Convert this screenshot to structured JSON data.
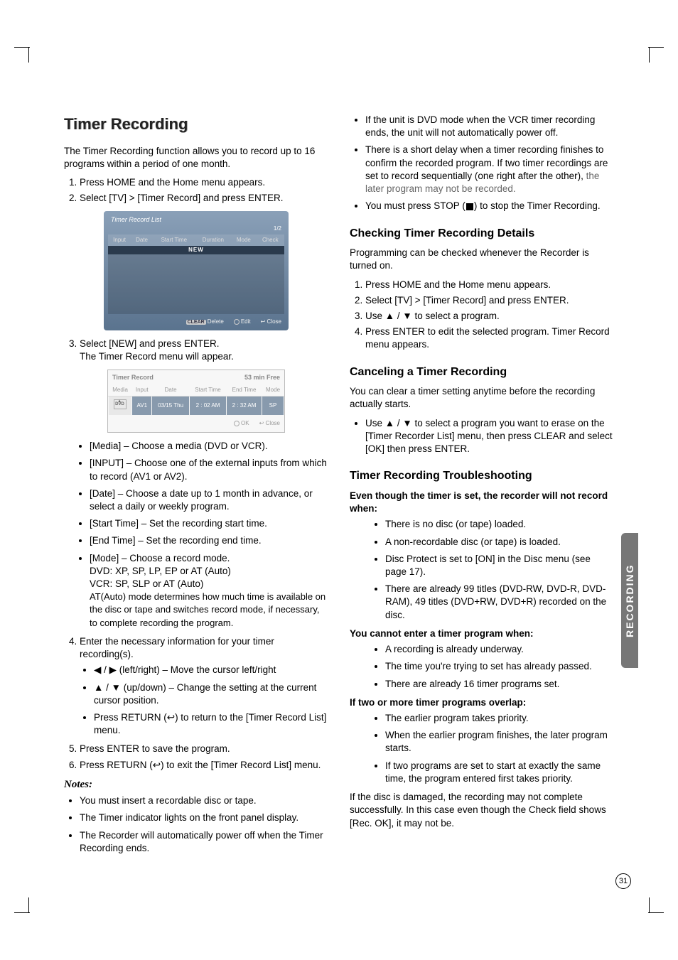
{
  "sideTab": "RECORDING",
  "pageNumber": "31",
  "left": {
    "title": "Timer Recording",
    "intro": "The Timer Recording function allows you to record up to 16 programs within a period of one month.",
    "steps1": [
      "Press HOME and the Home menu appears.",
      "Select [TV] > [Timer Record] and press ENTER."
    ],
    "shot1": {
      "title": "Timer Record List",
      "page": "1/2",
      "cols": [
        "Input",
        "Date",
        "Start Time",
        "Duration",
        "Mode",
        "Check"
      ],
      "new": "NEW",
      "foot_delete": "Delete",
      "foot_delete_key": "CLEAR",
      "foot_edit": "Edit",
      "foot_close": "Close"
    },
    "step3_a": "Select [NEW] and press ENTER.",
    "step3_b": "The Timer Record menu will appear.",
    "shot2": {
      "title": "Timer Record",
      "free": "53  min Free",
      "cols": [
        "Media",
        "Input",
        "Date",
        "Start Time",
        "End Time",
        "Mode"
      ],
      "row": [
        "",
        "AV1",
        "03/15 Thu",
        "2 : 02 AM",
        "2 : 32 AM",
        "SP"
      ],
      "foot_ok": "OK",
      "foot_close": "Close"
    },
    "defs": [
      "[Media] – Choose a media (DVD or VCR).",
      "[INPUT] – Choose one of the external inputs from which to record (AV1 or AV2).",
      "[Date] – Choose a date up to 1 month in advance, or select a daily or weekly program.",
      "[Start Time] – Set the recording start time.",
      "[End Time] – Set the recording end time."
    ],
    "mode_a": "[Mode] – Choose a record mode.",
    "mode_b": "DVD: XP, SP, LP, EP or AT (Auto)",
    "mode_c": "VCR: SP, SLP or AT (Auto)",
    "mode_d": "AT(Auto) mode determines how much time is available on the disc or tape and switches record mode, if necessary, to complete recording the program.",
    "step4": "Enter the necessary information for your timer recording(s).",
    "nav": [
      "◀ / ▶ (left/right) – Move the cursor left/right",
      "▲ / ▼ (up/down) – Change the setting at the current cursor position."
    ],
    "nav_return": "Press RETURN (↩) to return to the [Timer Record List] menu.",
    "step5": "Press ENTER to save the program.",
    "step6": "Press RETURN (↩) to exit the [Timer Record List] menu.",
    "notes_h": "Notes:",
    "notes": [
      "You must insert a recordable disc or tape.",
      "The Timer indicator lights on the front panel display.",
      "The Recorder will automatically power off when the Timer Recording ends."
    ]
  },
  "right": {
    "topnotes_a": "If the unit is DVD mode when the VCR timer recording ends, the unit will not automatically power off.",
    "topnotes_b1": "There is a short delay when a timer recording finishes to confirm the recorded program. If two timer recordings are set to record sequentially (one right after the other), ",
    "topnotes_b2": "the later program may not be recorded.",
    "topnotes_c1": "You must press STOP (",
    "topnotes_c2": ") to stop the Timer Recording.",
    "h_check": "Checking Timer Recording Details",
    "check_intro": "Programming can be checked whenever the Recorder is turned on.",
    "check_steps": [
      "Press HOME and the Home menu appears.",
      "Select [TV] > [Timer Record] and press ENTER.",
      "Use ▲ / ▼ to select a program.",
      "Press ENTER to edit the selected program. Timer Record menu appears."
    ],
    "h_cancel": "Canceling a Timer Recording",
    "cancel_intro": "You can clear a timer setting anytime before the recording actually starts.",
    "cancel_bul": "Use ▲ / ▼ to select a program you want to erase on the [Timer Recorder List] menu, then press CLEAR and select [OK] then press ENTER.",
    "h_trouble": "Timer Recording Troubleshooting",
    "trouble_h1": "Even though the timer is set, the recorder will not record when:",
    "trouble_l1": [
      "There is no disc (or tape) loaded.",
      "A non-recordable disc (or tape) is loaded.",
      "Disc Protect is set to [ON] in the Disc menu (see page 17).",
      "There are already 99 titles (DVD-RW, DVD-R, DVD-RAM), 49 titles (DVD+RW, DVD+R) recorded on the disc."
    ],
    "trouble_h2": "You cannot enter a timer program when:",
    "trouble_l2": [
      "A recording is already underway.",
      "The time you're trying to set has already passed.",
      "There are already 16 timer programs set."
    ],
    "trouble_h3": "If two or more timer programs overlap:",
    "trouble_l3": [
      "The earlier program takes priority.",
      "When the earlier program finishes, the later program starts.",
      "If two programs are set to start at exactly the same time, the program entered first takes priority."
    ],
    "end": "If the disc is damaged, the recording may not complete successfully. In this case even though the Check field shows [Rec. OK], it may not be."
  }
}
